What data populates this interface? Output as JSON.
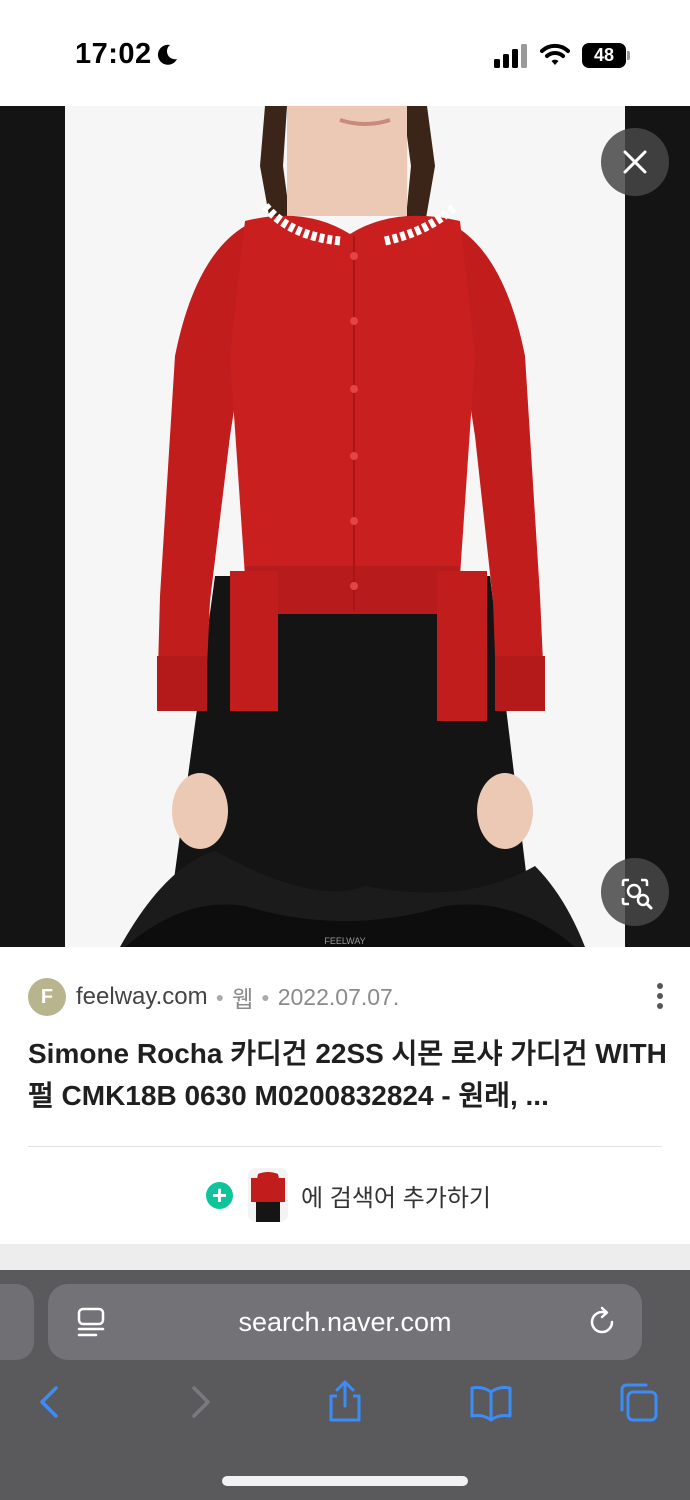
{
  "status": {
    "time": "17:02",
    "battery": "48"
  },
  "viewer": {
    "watermark": "FEELWAY",
    "colors": {
      "cardigan": "#c21d1d",
      "skirt": "#141414"
    }
  },
  "result": {
    "favicon_letter": "F",
    "site": "feelway.com",
    "type": "웹",
    "date": "2022.07.07.",
    "title": "Simone Rocha 카디건 22SS 시몬 로샤 가디건 WITH 펄 CMK18B 0630 M0200832824 - 원래, ...",
    "add_search_label": "에 검색어 추가하기"
  },
  "browser": {
    "url": "search.naver.com"
  },
  "icons": {
    "status": [
      "moon-icon",
      "signal-icon",
      "wifi-icon",
      "battery-icon"
    ],
    "viewer": [
      "close-icon",
      "image-search-icon"
    ],
    "card": [
      "more-icon",
      "plus-icon"
    ],
    "toolbar": [
      "reader-icon",
      "reload-icon",
      "back-icon",
      "forward-icon",
      "share-icon",
      "bookmarks-icon",
      "tabs-icon"
    ]
  }
}
